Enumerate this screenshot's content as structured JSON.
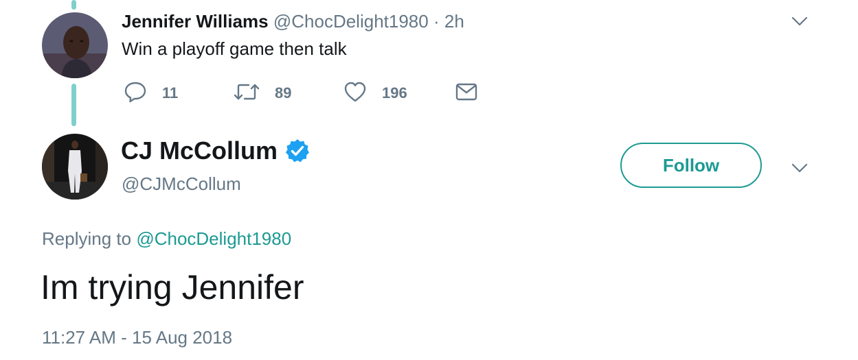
{
  "parent_tweet": {
    "author_name": "Jennifer Williams",
    "author_handle": "@ChocDelight1980",
    "separator": "·",
    "time_ago": "2h",
    "text": "Win a playoff game then talk",
    "actions": {
      "reply_count": "11",
      "retweet_count": "89",
      "like_count": "196"
    },
    "icons": [
      "reply-icon",
      "retweet-icon",
      "like-icon",
      "message-icon",
      "chevron-down-icon"
    ]
  },
  "main_tweet": {
    "author_name": "CJ McCollum",
    "author_handle": "@CJMcCollum",
    "verified": true,
    "follow_label": "Follow",
    "replying_prefix": "Replying to",
    "replying_to": "@ChocDelight1980",
    "text": "Im trying Jennifer",
    "timestamp": "11:27 AM - 15 Aug 2018"
  },
  "colors": {
    "accent": "#1c9a93",
    "thread_line": "#7fcfcc",
    "text_primary": "#14171a",
    "text_secondary": "#657786",
    "verified_blue": "#1da1f2"
  }
}
